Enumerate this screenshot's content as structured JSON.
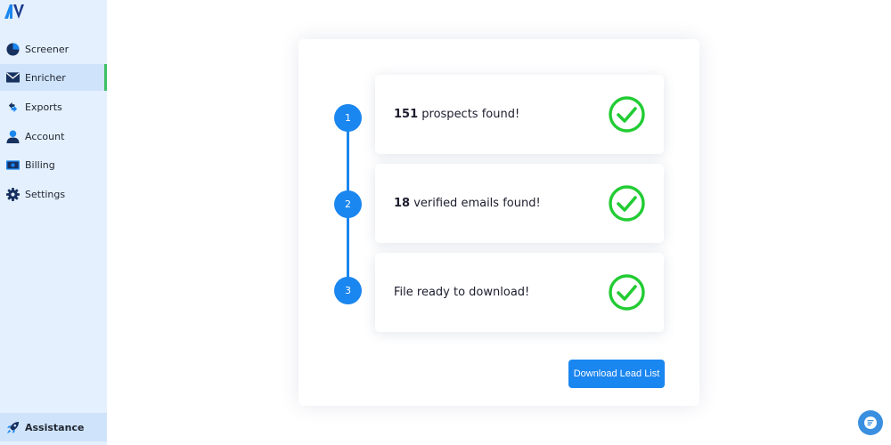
{
  "sidebar": {
    "logo_icon": "av-logo-icon",
    "items": [
      {
        "label": "Screener",
        "icon": "pie-chart-icon",
        "active": false
      },
      {
        "label": "Enricher",
        "icon": "envelope-icon",
        "active": true
      },
      {
        "label": "Exports",
        "icon": "transfer-arrows-icon",
        "active": false
      },
      {
        "label": "Account",
        "icon": "user-icon",
        "active": false
      },
      {
        "label": "Billing",
        "icon": "money-bill-icon",
        "active": false
      },
      {
        "label": "Settings",
        "icon": "gear-icon",
        "active": false
      }
    ],
    "assistance": {
      "label": "Assistance",
      "icon": "rocket-icon"
    }
  },
  "steps": [
    {
      "number": "1",
      "count": "151",
      "text": " prospects found!",
      "status_icon": "check-circle-icon"
    },
    {
      "number": "2",
      "count": "18",
      "text": " verified emails found!",
      "status_icon": "check-circle-icon"
    },
    {
      "number": "3",
      "count": "",
      "text": "File ready to download!",
      "status_icon": "check-circle-icon"
    }
  ],
  "actions": {
    "download_label": "Download Lead List"
  },
  "chat": {
    "icon": "chat-bubble-icon"
  },
  "colors": {
    "accent": "#1a86f0",
    "success": "#22cc33",
    "sidebar_bg": "#e4f0fd",
    "active_indicator": "#3fbf63"
  }
}
